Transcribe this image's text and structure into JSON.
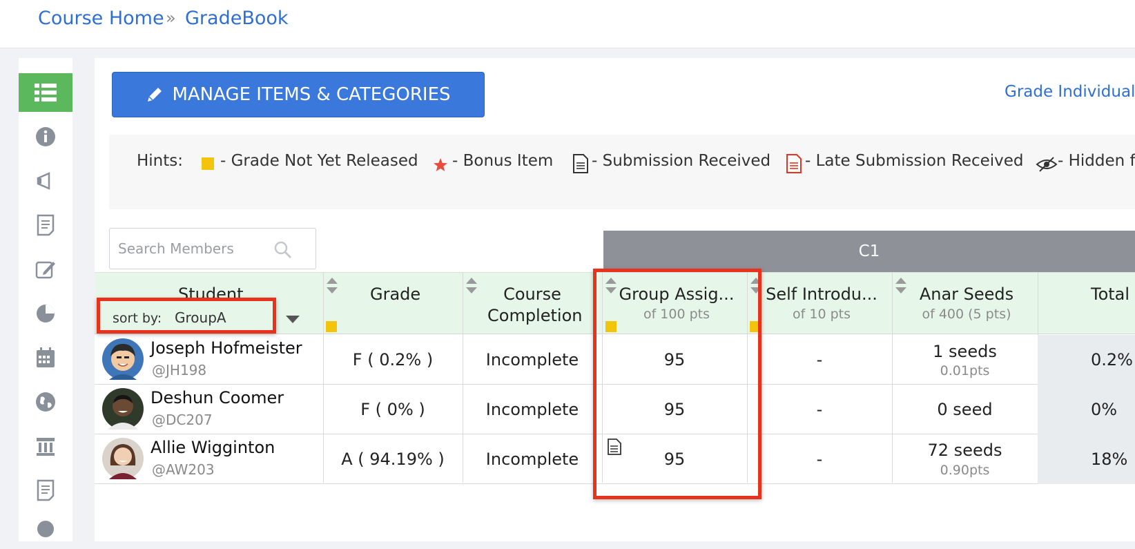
{
  "breadcrumb": {
    "home": "Course Home",
    "separator": "»",
    "current": "GradeBook"
  },
  "sidebar": {
    "items": [
      {
        "icon": "list-icon",
        "active": true
      },
      {
        "icon": "info-icon"
      },
      {
        "icon": "megaphone-icon"
      },
      {
        "icon": "document-icon"
      },
      {
        "icon": "edit-icon"
      },
      {
        "icon": "pie-chart-icon"
      },
      {
        "icon": "calendar-icon"
      },
      {
        "icon": "globe-icon"
      },
      {
        "icon": "pillar-icon"
      },
      {
        "icon": "document-icon"
      },
      {
        "icon": "chat-icon"
      }
    ],
    "active_color": "#5cb85c"
  },
  "toolbar": {
    "manage_label": "MANAGE ITEMS & CATEGORIES",
    "grade_individually": "Grade Individuall"
  },
  "hints": {
    "label": "Hints:",
    "items": [
      "- Grade Not Yet Released",
      "- Bonus Item",
      "- Submission Received",
      "- Late Submission Received",
      "- Hidden f"
    ]
  },
  "search": {
    "placeholder": "Search Members"
  },
  "category_band": {
    "label": "C1"
  },
  "columns": {
    "student": "Student",
    "sort_label": "sort by:",
    "sort_value": "GroupA",
    "grade": "Grade",
    "course_completion_1": "Course",
    "course_completion_2": "Completion",
    "group": {
      "title": "Group Assig...",
      "sub": "of 100 pts"
    },
    "self": {
      "title": "Self Introdu...",
      "sub": "of 10 pts"
    },
    "anar": {
      "title": "Anar Seeds",
      "sub": "of 400 (5 pts)"
    },
    "total": "Total"
  },
  "rows": [
    {
      "name": "Joseph Hofmeister",
      "handle": "@JH198",
      "grade": "F ( 0.2% )",
      "completion": "Incomplete",
      "group": "95",
      "self": "-",
      "anar": "1 seeds",
      "anar_sub": "0.01pts",
      "total": "0.2%"
    },
    {
      "name": "Deshun Coomer",
      "handle": "@DC207",
      "grade": "F ( 0% )",
      "completion": "Incomplete",
      "group": "95",
      "self": "-",
      "anar": "0 seed",
      "anar_sub": "",
      "total": "0%"
    },
    {
      "name": "Allie Wigginton",
      "handle": "@AW203",
      "grade": "A ( 94.19% )",
      "completion": "Incomplete",
      "group": "95",
      "self": "-",
      "anar": "72 seeds",
      "anar_sub": "0.90pts",
      "total": "18%"
    }
  ],
  "colors": {
    "accent": "#3a78dc",
    "header_bg": "#e6f7e9",
    "highlight": "#e8321e",
    "not_released": "#f2c40c",
    "bonus": "#e84c3d"
  }
}
